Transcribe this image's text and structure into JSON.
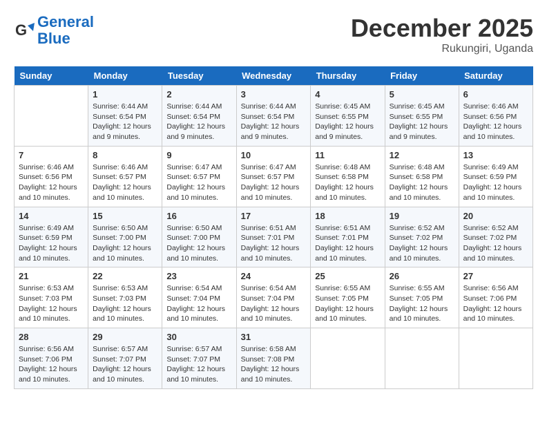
{
  "header": {
    "logo_line1": "General",
    "logo_line2": "Blue",
    "month_title": "December 2025",
    "location": "Rukungiri, Uganda"
  },
  "days_of_week": [
    "Sunday",
    "Monday",
    "Tuesday",
    "Wednesday",
    "Thursday",
    "Friday",
    "Saturday"
  ],
  "weeks": [
    [
      {
        "day": "",
        "info": ""
      },
      {
        "day": "1",
        "info": "Sunrise: 6:44 AM\nSunset: 6:54 PM\nDaylight: 12 hours and 9 minutes."
      },
      {
        "day": "2",
        "info": "Sunrise: 6:44 AM\nSunset: 6:54 PM\nDaylight: 12 hours and 9 minutes."
      },
      {
        "day": "3",
        "info": "Sunrise: 6:44 AM\nSunset: 6:54 PM\nDaylight: 12 hours and 9 minutes."
      },
      {
        "day": "4",
        "info": "Sunrise: 6:45 AM\nSunset: 6:55 PM\nDaylight: 12 hours and 9 minutes."
      },
      {
        "day": "5",
        "info": "Sunrise: 6:45 AM\nSunset: 6:55 PM\nDaylight: 12 hours and 9 minutes."
      },
      {
        "day": "6",
        "info": "Sunrise: 6:46 AM\nSunset: 6:56 PM\nDaylight: 12 hours and 10 minutes."
      }
    ],
    [
      {
        "day": "7",
        "info": "Sunrise: 6:46 AM\nSunset: 6:56 PM\nDaylight: 12 hours and 10 minutes."
      },
      {
        "day": "8",
        "info": "Sunrise: 6:46 AM\nSunset: 6:57 PM\nDaylight: 12 hours and 10 minutes."
      },
      {
        "day": "9",
        "info": "Sunrise: 6:47 AM\nSunset: 6:57 PM\nDaylight: 12 hours and 10 minutes."
      },
      {
        "day": "10",
        "info": "Sunrise: 6:47 AM\nSunset: 6:57 PM\nDaylight: 12 hours and 10 minutes."
      },
      {
        "day": "11",
        "info": "Sunrise: 6:48 AM\nSunset: 6:58 PM\nDaylight: 12 hours and 10 minutes."
      },
      {
        "day": "12",
        "info": "Sunrise: 6:48 AM\nSunset: 6:58 PM\nDaylight: 12 hours and 10 minutes."
      },
      {
        "day": "13",
        "info": "Sunrise: 6:49 AM\nSunset: 6:59 PM\nDaylight: 12 hours and 10 minutes."
      }
    ],
    [
      {
        "day": "14",
        "info": "Sunrise: 6:49 AM\nSunset: 6:59 PM\nDaylight: 12 hours and 10 minutes."
      },
      {
        "day": "15",
        "info": "Sunrise: 6:50 AM\nSunset: 7:00 PM\nDaylight: 12 hours and 10 minutes."
      },
      {
        "day": "16",
        "info": "Sunrise: 6:50 AM\nSunset: 7:00 PM\nDaylight: 12 hours and 10 minutes."
      },
      {
        "day": "17",
        "info": "Sunrise: 6:51 AM\nSunset: 7:01 PM\nDaylight: 12 hours and 10 minutes."
      },
      {
        "day": "18",
        "info": "Sunrise: 6:51 AM\nSunset: 7:01 PM\nDaylight: 12 hours and 10 minutes."
      },
      {
        "day": "19",
        "info": "Sunrise: 6:52 AM\nSunset: 7:02 PM\nDaylight: 12 hours and 10 minutes."
      },
      {
        "day": "20",
        "info": "Sunrise: 6:52 AM\nSunset: 7:02 PM\nDaylight: 12 hours and 10 minutes."
      }
    ],
    [
      {
        "day": "21",
        "info": "Sunrise: 6:53 AM\nSunset: 7:03 PM\nDaylight: 12 hours and 10 minutes."
      },
      {
        "day": "22",
        "info": "Sunrise: 6:53 AM\nSunset: 7:03 PM\nDaylight: 12 hours and 10 minutes."
      },
      {
        "day": "23",
        "info": "Sunrise: 6:54 AM\nSunset: 7:04 PM\nDaylight: 12 hours and 10 minutes."
      },
      {
        "day": "24",
        "info": "Sunrise: 6:54 AM\nSunset: 7:04 PM\nDaylight: 12 hours and 10 minutes."
      },
      {
        "day": "25",
        "info": "Sunrise: 6:55 AM\nSunset: 7:05 PM\nDaylight: 12 hours and 10 minutes."
      },
      {
        "day": "26",
        "info": "Sunrise: 6:55 AM\nSunset: 7:05 PM\nDaylight: 12 hours and 10 minutes."
      },
      {
        "day": "27",
        "info": "Sunrise: 6:56 AM\nSunset: 7:06 PM\nDaylight: 12 hours and 10 minutes."
      }
    ],
    [
      {
        "day": "28",
        "info": "Sunrise: 6:56 AM\nSunset: 7:06 PM\nDaylight: 12 hours and 10 minutes."
      },
      {
        "day": "29",
        "info": "Sunrise: 6:57 AM\nSunset: 7:07 PM\nDaylight: 12 hours and 10 minutes."
      },
      {
        "day": "30",
        "info": "Sunrise: 6:57 AM\nSunset: 7:07 PM\nDaylight: 12 hours and 10 minutes."
      },
      {
        "day": "31",
        "info": "Sunrise: 6:58 AM\nSunset: 7:08 PM\nDaylight: 12 hours and 10 minutes."
      },
      {
        "day": "",
        "info": ""
      },
      {
        "day": "",
        "info": ""
      },
      {
        "day": "",
        "info": ""
      }
    ]
  ]
}
